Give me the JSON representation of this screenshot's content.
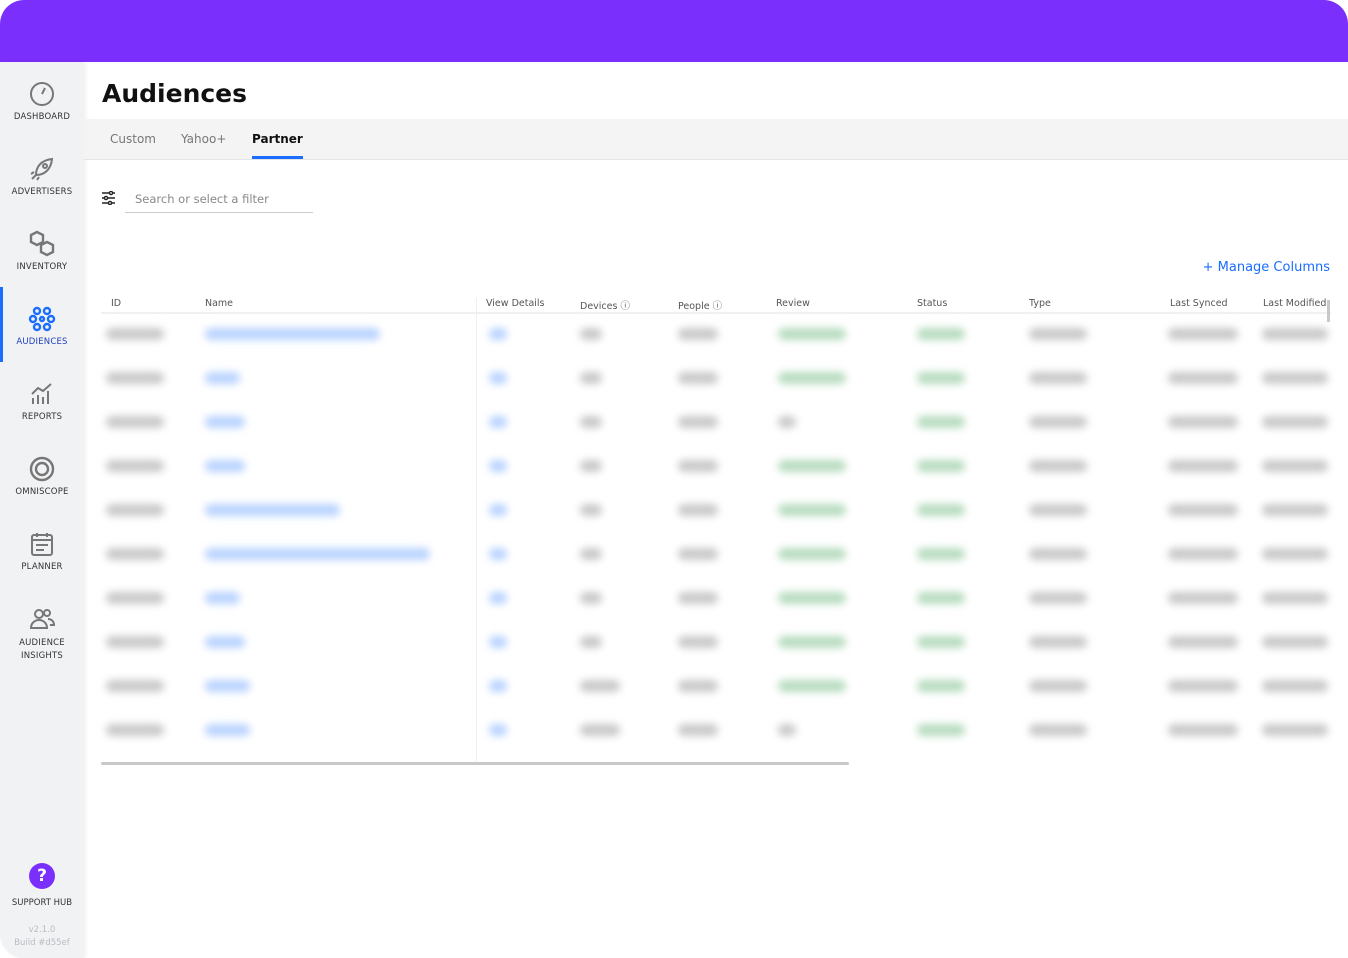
{
  "sidebar": {
    "items": [
      {
        "label": "DASHBOARD",
        "icon": "gauge-icon"
      },
      {
        "label": "ADVERTISERS",
        "icon": "rocket-icon"
      },
      {
        "label": "INVENTORY",
        "icon": "cubes-icon"
      },
      {
        "label": "AUDIENCES",
        "icon": "network-icon",
        "active": true
      },
      {
        "label": "REPORTS",
        "icon": "bar-chart-icon"
      },
      {
        "label": "OMNISCOPE",
        "icon": "ring-icon"
      },
      {
        "label": "PLANNER",
        "icon": "calendar-icon"
      },
      {
        "label": "AUDIENCE INSIGHTS",
        "icon": "people-icon"
      }
    ],
    "support": "SUPPORT HUB",
    "version": "v2.1.0",
    "build": "Build #d55ef"
  },
  "page": {
    "title": "Audiences"
  },
  "tabs": [
    "Custom",
    "Yahoo+",
    "Partner"
  ],
  "active_tab": "Partner",
  "search": {
    "placeholder": "Search or select a filter"
  },
  "manage_columns": "+ Manage Columns",
  "table": {
    "columns": [
      "ID",
      "Name",
      "View Details",
      "Devices ⓘ",
      "People ⓘ",
      "Review",
      "Status",
      "Type",
      "Last Synced",
      "Last Modified"
    ],
    "row_count": 10,
    "content": "blurred"
  },
  "colors": {
    "brand": "#7b2ffc",
    "accent": "#1a6dff"
  }
}
